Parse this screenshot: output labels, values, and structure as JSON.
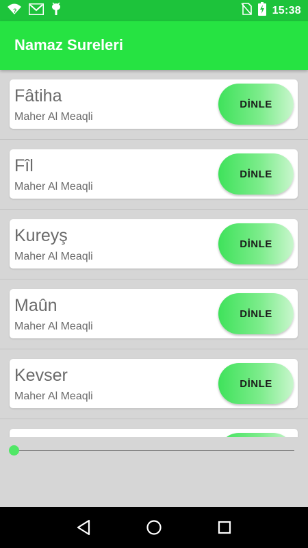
{
  "status_bar": {
    "time": "15:38",
    "icons": [
      "wifi-unknown-icon",
      "gmail-icon",
      "android-debug-icon",
      "no-sim-icon",
      "battery-charging-icon"
    ]
  },
  "app_bar": {
    "title": "Namaz Sureleri"
  },
  "surahs": [
    {
      "title": "Fâtiha",
      "reciter": "Maher Al Meaqli",
      "button": "DİNLE"
    },
    {
      "title": "Fîl",
      "reciter": "Maher Al Meaqli",
      "button": "DİNLE"
    },
    {
      "title": "Kureyş",
      "reciter": "Maher Al Meaqli",
      "button": "DİNLE"
    },
    {
      "title": "Maûn",
      "reciter": "Maher Al Meaqli",
      "button": "DİNLE"
    },
    {
      "title": "Kevser",
      "reciter": "Maher Al Meaqli",
      "button": "DİNLE"
    },
    {
      "title": "",
      "reciter": "",
      "button": ""
    }
  ],
  "player": {
    "progress": 0
  },
  "nav_bar": {
    "buttons": [
      "back-icon",
      "home-icon",
      "recents-icon"
    ]
  },
  "colors": {
    "status_bar": "#1dc33b",
    "app_bar": "#26e342",
    "accent": "#50e766"
  }
}
